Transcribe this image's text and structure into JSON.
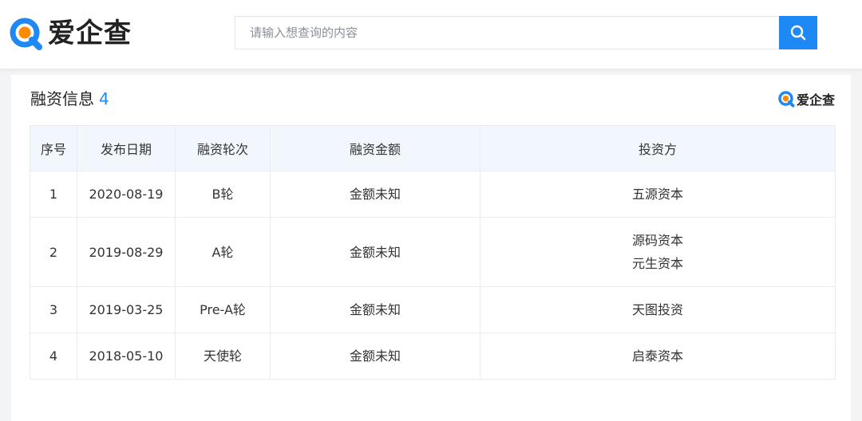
{
  "header": {
    "logo_text": "爱企查",
    "search_placeholder": "请输入想查询的内容"
  },
  "section": {
    "title": "融资信息",
    "count": "4",
    "watermark_text": "爱企查"
  },
  "table": {
    "columns": [
      "序号",
      "发布日期",
      "融资轮次",
      "融资金额",
      "投资方"
    ],
    "rows": [
      {
        "index": "1",
        "date": "2020-08-19",
        "round": "B轮",
        "amount": "金额未知",
        "investors": [
          "五源资本"
        ]
      },
      {
        "index": "2",
        "date": "2019-08-29",
        "round": "A轮",
        "amount": "金额未知",
        "investors": [
          "源码资本",
          "元生资本"
        ]
      },
      {
        "index": "3",
        "date": "2019-03-25",
        "round": "Pre-A轮",
        "amount": "金额未知",
        "investors": [
          "天图投资"
        ]
      },
      {
        "index": "4",
        "date": "2018-05-10",
        "round": "天使轮",
        "amount": "金额未知",
        "investors": [
          "启泰资本"
        ]
      }
    ]
  },
  "colors": {
    "brand_blue": "#1e88f5",
    "brand_orange": "#ff8a00",
    "header_row_bg": "#f2f7fe"
  }
}
